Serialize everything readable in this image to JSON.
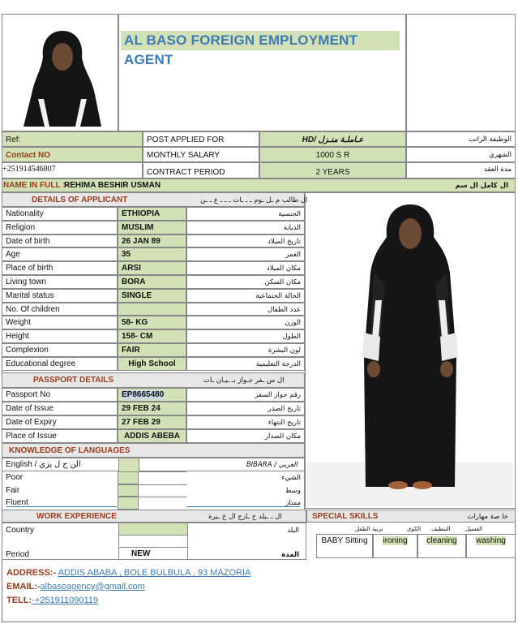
{
  "agency": {
    "title": "AL BASO   FOREIGN EMPLOYMENT AGENT"
  },
  "top_info": {
    "ref_label": "Ref:",
    "contact_label": "Contact NO",
    "contact_value": "+251914546807",
    "post_label": "POST  APPLIED  FOR",
    "post_value": "HD/ عـاملـة منـزل",
    "post_ar": "الوظيفة الراتب",
    "salary_label": "MONTHLY SALARY",
    "salary_value": "1000 S R",
    "salary_ar": "الشهري",
    "contract_label": "CONTRACT PERIOD",
    "contract_value": "2 YEARS",
    "contract_ar": "مدة العقد"
  },
  "name": {
    "label": "NAME IN FULL :-",
    "value": "REHIMA BESHIR USMAN",
    "ar": "ال كامل ال سم"
  },
  "details": {
    "header": "DETAILS OF APPLICANT",
    "header_ar": "ال طالب م ـل ـوم ـ ـ ـات ـ ـ ـ ع ـ ـن",
    "rows": [
      {
        "label": "Nationality",
        "value": "ETHIOPIA",
        "ar": "الجنسية"
      },
      {
        "label": "Religion",
        "value": "MUSLIM",
        "ar": "الديانة"
      },
      {
        "label": "Date of birth",
        "value": "26 JAN 89",
        "ar": "تاريخ الميلاد"
      },
      {
        "label": "Age",
        "value": "35",
        "ar": "العمر"
      },
      {
        "label": "Place of birth",
        "value": "ARSI",
        "ar": "مكان الميلاد"
      },
      {
        "label": "Living town",
        "value": "BORA",
        "ar": "مكان السكن"
      },
      {
        "label": "Marital status",
        "value": "SINGLE",
        "ar": "الحالة الجتماعية"
      },
      {
        "label": "No. Of children",
        "value": "",
        "ar": "عدد الطفال"
      },
      {
        "label": "Weight",
        "value": "58- KG",
        "ar": "الوزن"
      },
      {
        "label": "Height",
        "value": "158- CM",
        "ar": "الطول"
      },
      {
        "label": "Complexion",
        "value": "FAIR",
        "ar": "لون البشرة"
      },
      {
        "label": "Educational degree",
        "value": "High School",
        "ar": "الدرجة التعليمية"
      }
    ]
  },
  "passport": {
    "header": "PASSPORT DETAILS",
    "header_ar": "ال س ـفر جـواز بـ ـيـان ـات",
    "rows": [
      {
        "label": "Passport No",
        "value": "EP8665480",
        "ar": "رقم جواز السفر"
      },
      {
        "label": "Date of Issue",
        "value": "29 FEB 24",
        "ar": "تاريخ الصدر"
      },
      {
        "label": "Date of Expiry",
        "value": "27 FEB 29",
        "ar": "تاريخ النتهاء"
      },
      {
        "label": "Place of Issue",
        "value": "ADDIS ABEBA",
        "ar": "مكان الصدار"
      }
    ]
  },
  "languages": {
    "header": "KNOWLEDGE OF LANGUAGES",
    "english_label": "English / الن ج ل يزي",
    "arabic_label": "العربي / BIBARA",
    "rows": [
      {
        "label": "Poor",
        "ar": "الشيء"
      },
      {
        "label": "Fair",
        "ar": "وسط"
      },
      {
        "label": "Fluent",
        "ar": "ممتاز"
      }
    ]
  },
  "work": {
    "header": "WORK EXPERIENCE",
    "header_ar": "ال ـ ـبلد خ ـارج ال خ ـبرة",
    "country_label": "Country",
    "country_ar": "البلد",
    "period_label": "Period",
    "period_value": "NEW",
    "period_ar": "المدة"
  },
  "skills": {
    "header": "SPECIAL SKILLS",
    "header_ar": "خا صة مهارات",
    "sub_ar": [
      "تربية الطفل",
      "الكوي",
      "التنظيف",
      "الغسيل"
    ],
    "items": [
      "BABY Sitting",
      "ironing",
      "cleaning",
      "washing"
    ]
  },
  "footer": {
    "address_label": "ADDRESS:-",
    "address_value": "ADDIS ABABA ,  BOLE  BULBULA  , 93 MAZORIA",
    "email_label": "EMAIL:-",
    "email_value": "albasoagency@gmail.com",
    "tel_label": "TELL:",
    "tel_value": "-+251911090119"
  }
}
